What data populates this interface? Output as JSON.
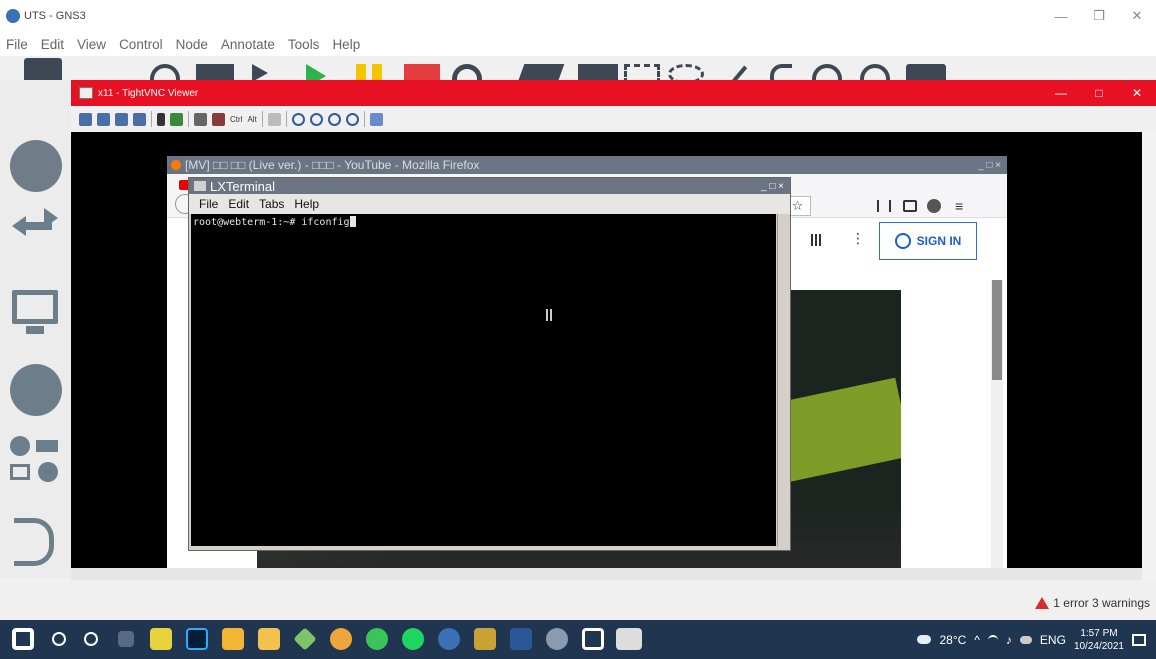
{
  "gns3": {
    "title": "UTS - GNS3",
    "menu": [
      "File",
      "Edit",
      "View",
      "Control",
      "Node",
      "Annotate",
      "Tools",
      "Help"
    ],
    "status": "1 error 3 warnings"
  },
  "vnc": {
    "title": "x11 - TightVNC Viewer",
    "toolbar_ctrl": "Ctrl",
    "toolbar_alt": "Alt"
  },
  "firefox": {
    "title": "[MV] □□ □□ (Live ver.) - □□□ - YouTube - Mozilla Firefox",
    "sign_in": "SIGN IN"
  },
  "lxterminal": {
    "title": "LXTerminal",
    "menu": [
      "File",
      "Edit",
      "Tabs",
      "Help"
    ],
    "prompt": "root@webterm-1:~# ifconfig"
  },
  "taskbar": {
    "weather": "28°C",
    "language": "ENG",
    "time": "1:57 PM",
    "date": "10/24/2021"
  },
  "colors": {
    "vnc_title": "#e81123",
    "taskbar": "#1f3550",
    "firefox_title": "#6a7483"
  }
}
